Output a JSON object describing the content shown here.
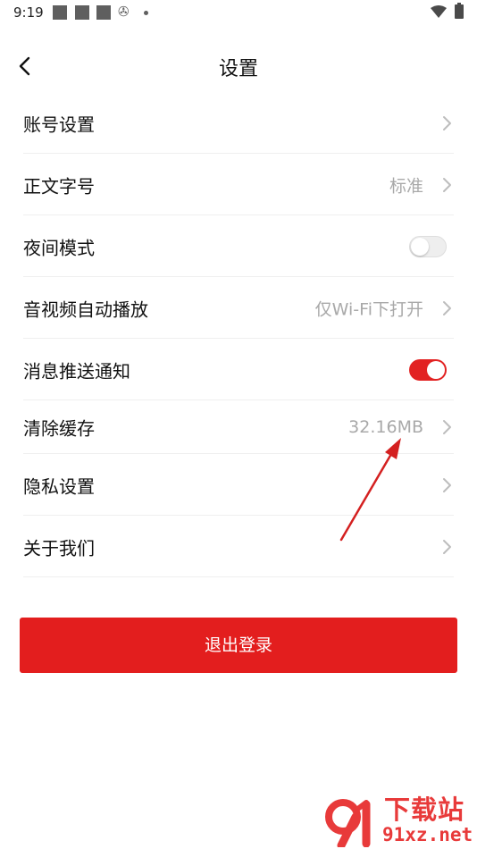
{
  "status_bar": {
    "time": "9:19",
    "icons": [
      "square-notification-icon",
      "square-notification-icon",
      "square-notification-icon",
      "gear-icon",
      "dot-icon",
      "wifi-icon",
      "battery-icon"
    ]
  },
  "header": {
    "title": "设置",
    "back_icon": "chevron-left-icon"
  },
  "settings": {
    "account": {
      "label": "账号设置"
    },
    "font_size": {
      "label": "正文字号",
      "value": "标准"
    },
    "night_mode": {
      "label": "夜间模式",
      "enabled": false
    },
    "autoplay": {
      "label": "音视频自动播放",
      "value": "仅Wi-Fi下打开"
    },
    "push": {
      "label": "消息推送通知",
      "enabled": true
    },
    "cache": {
      "label": "清除缓存",
      "value": "32.16MB"
    },
    "privacy": {
      "label": "隐私设置"
    },
    "about": {
      "label": "关于我们"
    }
  },
  "logout": {
    "label": "退出登录"
  },
  "watermark": {
    "brand": "下载站",
    "domain": "91xz.net",
    "logo_text": "91"
  },
  "colors": {
    "accent": "#e31e1e",
    "annotation": "#d42020",
    "value_text": "#a9a9a9",
    "chevron": "#bdbdbd"
  }
}
